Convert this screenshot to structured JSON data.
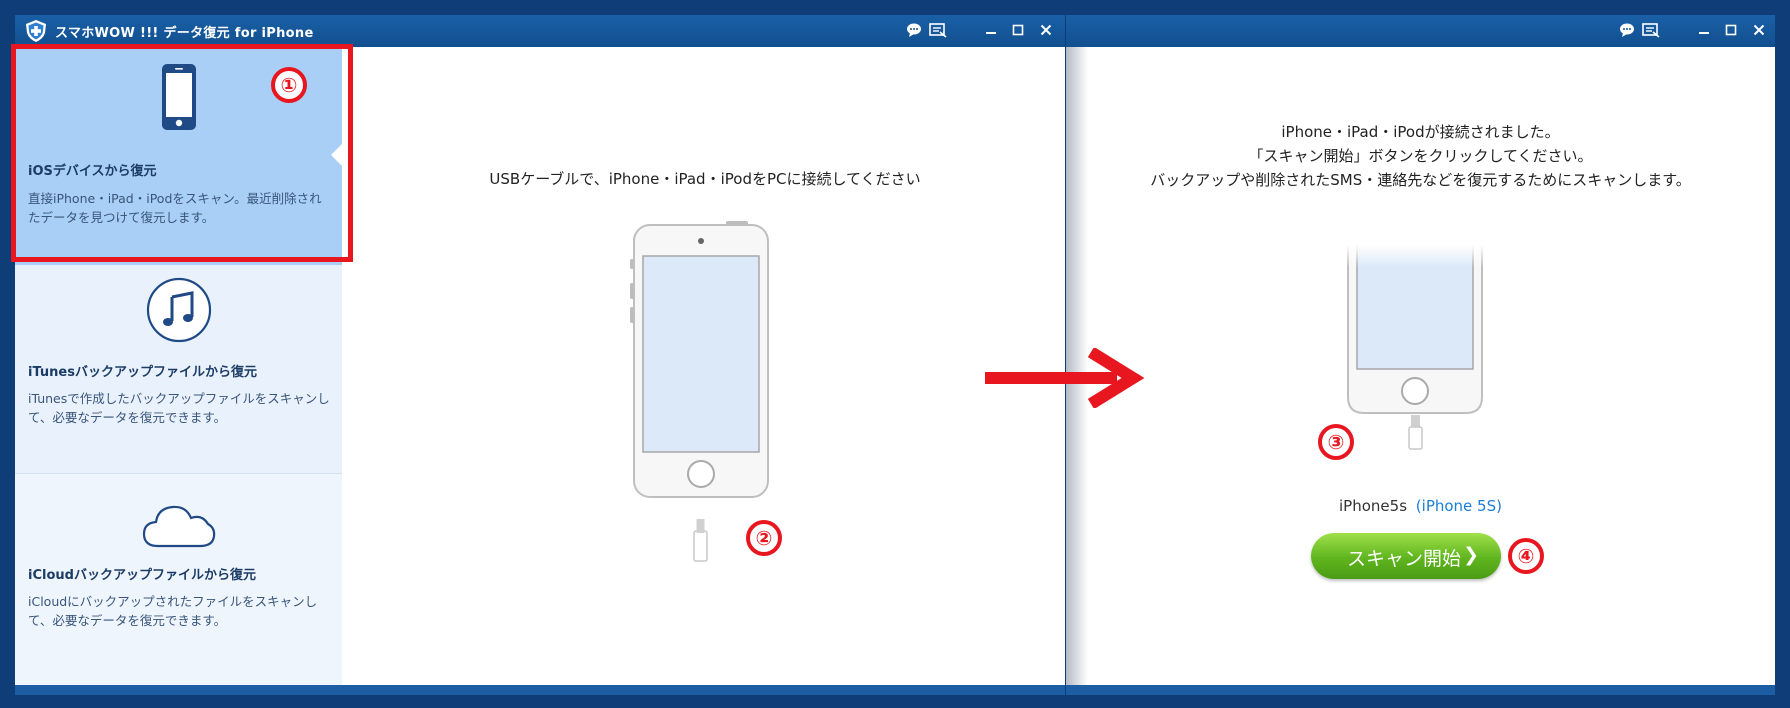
{
  "window": {
    "title": "スマホWOW !!! データ復元 for iPhone",
    "controls": [
      "feedback-icon",
      "register-icon",
      "minimize-icon",
      "maximize-icon",
      "close-icon"
    ]
  },
  "sidebar": {
    "items": [
      {
        "title": "iOSデバイスから復元",
        "desc": "直接iPhone・iPad・iPodをスキャン。最近削除されたデータを見つけて復元します。",
        "icon": "iphone-icon",
        "selected": true
      },
      {
        "title": "iTunesバックアップファイルから復元",
        "desc": "iTunesで作成したバックアップファイルをスキャンして、必要なデータを復元できます。",
        "icon": "music-note-icon",
        "selected": false
      },
      {
        "title": "iCloudバックアップファイルから復元",
        "desc": "iCloudにバックアップされたファイルをスキャンして、必要なデータを復元できます。",
        "icon": "cloud-icon",
        "selected": false
      }
    ]
  },
  "main": {
    "instruction": "USBケーブルで、iPhone・iPad・iPodをPCに接続してください"
  },
  "second": {
    "messages": [
      "iPhone・iPad・iPodが接続されました。",
      "「スキャン開始」ボタンをクリックしてください。",
      "バックアップや削除されたSMS・連絡先などを復元するためにスキャンします。"
    ],
    "device_name": "iPhone5s",
    "device_model": "(iPhone 5S)",
    "scan_button": "スキャン開始",
    "scan_chevron": "❯"
  },
  "badges": [
    "①",
    "②",
    "③",
    "④"
  ],
  "colors": {
    "accent": "#1a5fa6",
    "annotation": "#e8171f",
    "button": "#5fb51f",
    "link": "#1a7fd6"
  }
}
